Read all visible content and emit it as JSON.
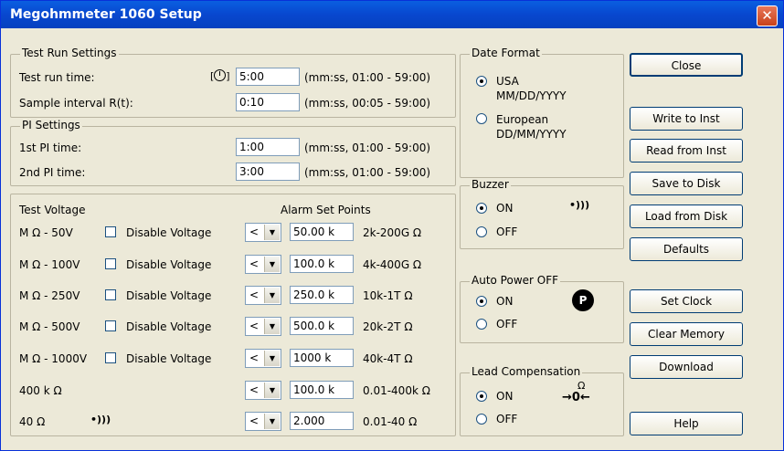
{
  "window": {
    "title": "Megohmmeter 1060 Setup",
    "close_glyph": "✕"
  },
  "test_run": {
    "group_label": "Test Run Settings",
    "run_time_label": "Test run time:",
    "run_time_value": "5:00",
    "run_time_hint": "(mm:ss, 01:00 - 59:00)",
    "interval_label": "Sample interval R(t):",
    "interval_value": "0:10",
    "interval_hint": "(mm:ss, 00:05 - 59:00)"
  },
  "pi": {
    "group_label": "PI Settings",
    "pi1_label": "1st PI time:",
    "pi1_value": "1:00",
    "pi1_hint": "(mm:ss, 01:00 - 59:00)",
    "pi2_label": "2nd PI time:",
    "pi2_value": "3:00",
    "pi2_hint": "(mm:ss, 01:00 - 59:00)"
  },
  "voltage": {
    "test_voltage_label": "Test Voltage",
    "alarm_label": "Alarm Set Points",
    "disable_label": "Disable Voltage",
    "rows": [
      {
        "name": "M Ω - 50V",
        "op": "<",
        "value": "50.00 k",
        "range": "2k-200G Ω"
      },
      {
        "name": "M Ω - 100V",
        "op": "<",
        "value": "100.0 k",
        "range": "4k-400G Ω"
      },
      {
        "name": "M Ω - 250V",
        "op": "<",
        "value": "250.0 k",
        "range": "10k-1T Ω"
      },
      {
        "name": "M Ω - 500V",
        "op": "<",
        "value": "500.0 k",
        "range": "20k-2T Ω"
      },
      {
        "name": "M Ω - 1000V",
        "op": "<",
        "value": "1000 k",
        "range": "40k-4T Ω"
      },
      {
        "name": "400 k Ω",
        "op": "<",
        "value": "100.0 k",
        "range": "0.01-400k Ω"
      },
      {
        "name": "40 Ω",
        "op": "<",
        "value": "2.000",
        "range": "0.01-40 Ω"
      }
    ]
  },
  "date_format": {
    "group_label": "Date Format",
    "usa_label": "USA",
    "usa_format": "MM/DD/YYYY",
    "eu_label": "European",
    "eu_format": "DD/MM/YYYY"
  },
  "buzzer": {
    "group_label": "Buzzer",
    "on": "ON",
    "off": "OFF"
  },
  "auto_power": {
    "group_label": "Auto Power OFF",
    "on": "ON",
    "off": "OFF",
    "badge": "P"
  },
  "lead_comp": {
    "group_label": "Lead Compensation",
    "on": "ON",
    "off": "OFF",
    "omega": "Ω",
    "symbol": "→0←"
  },
  "buttons": {
    "close": "Close",
    "write": "Write to Inst",
    "read": "Read from Inst",
    "save": "Save to Disk",
    "load": "Load from Disk",
    "defaults": "Defaults",
    "set_clock": "Set Clock",
    "clear_memory": "Clear Memory",
    "download": "Download",
    "help": "Help"
  },
  "icons": {
    "clock": "clock-icon",
    "speaker": "speaker-icon",
    "arrow": "chevron-down-icon"
  }
}
